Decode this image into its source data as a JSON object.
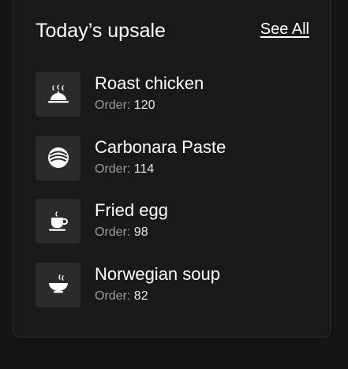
{
  "section": {
    "title": "Today’s upsale",
    "see_all_label": "See All"
  },
  "items": [
    {
      "name": "Roast chicken",
      "order_label": "Order:",
      "order_count": "120",
      "icon": "cloche-icon"
    },
    {
      "name": "Carbonara Paste",
      "order_label": "Order:",
      "order_count": "114",
      "icon": "noodle-bowl-icon"
    },
    {
      "name": "Fried egg",
      "order_label": "Order:",
      "order_count": "98",
      "icon": "coffee-cup-icon"
    },
    {
      "name": "Norwegian soup",
      "order_label": "Order:",
      "order_count": "82",
      "icon": "soup-bowl-icon"
    }
  ],
  "colors": {
    "background": "#141416",
    "card": "#19191b",
    "card_border": "#323236",
    "thumb": "#2b2b2e",
    "text_primary": "#ffffff",
    "text_muted": "#9a9aa0"
  }
}
